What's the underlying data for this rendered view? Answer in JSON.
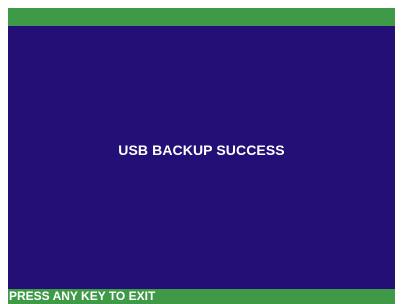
{
  "screen": {
    "message": "USB BACKUP SUCCESS",
    "footer_prompt": "PRESS ANY KEY TO EXIT"
  },
  "colors": {
    "background": "#230f75",
    "bar": "#3e9a47",
    "text": "#ffffff"
  }
}
